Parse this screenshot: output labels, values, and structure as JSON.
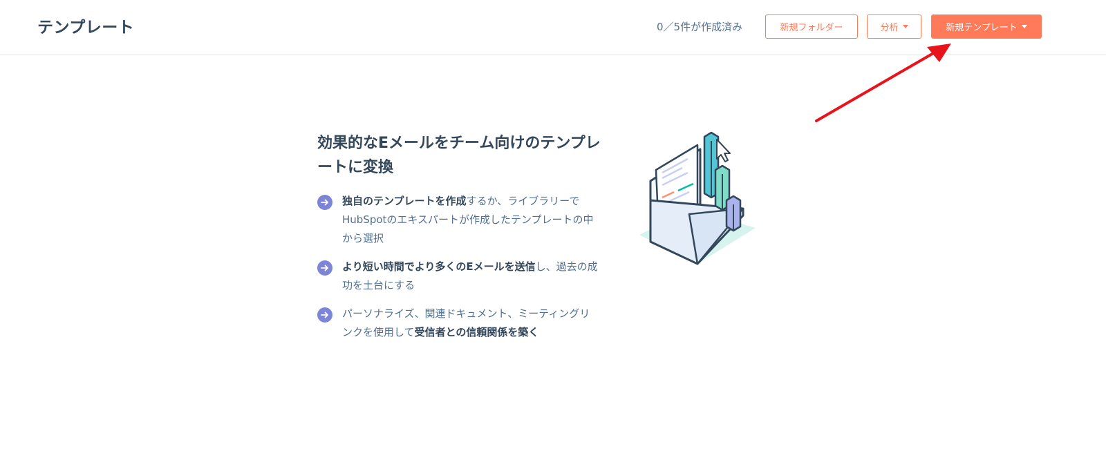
{
  "header": {
    "title": "テンプレート",
    "usage": "0／5件が作成済み",
    "new_folder_label": "新規フォルダー",
    "analyze_label": "分析",
    "new_template_label": "新規テンプレート"
  },
  "empty_state": {
    "headline": "効果的なEメールをチーム向けのテンプレートに変換",
    "benefits": [
      {
        "bold": "独自のテンプレートを作成",
        "text": "するか、ライブラリーでHubSpotのエキスパートが作成したテンプレートの中から選択"
      },
      {
        "bold": "より短い時間でより多くのEメールを送信",
        "text": "し、過去の成功を土台にする"
      },
      {
        "text": "パーソナライズ、関連ドキュメント、ミーティングリンクを使用して",
        "bold": "受信者との信頼関係を築く"
      }
    ]
  },
  "colors": {
    "accent": "#ff7a59",
    "text_dark": "#33475b",
    "text_muted": "#516f90",
    "bullet": "#7c85d6",
    "annotation_arrow": "#e8141b"
  }
}
